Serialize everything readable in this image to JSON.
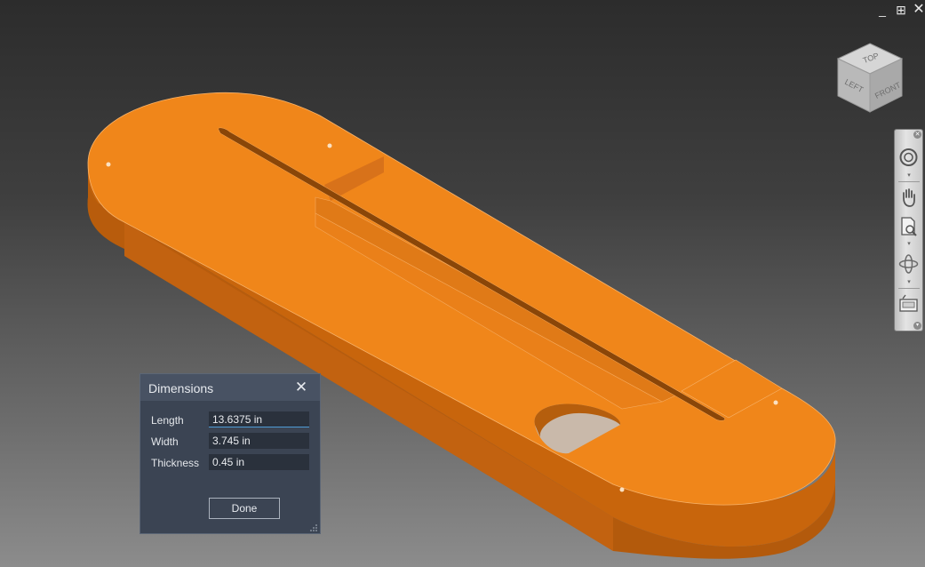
{
  "window": {
    "minimize_icon": "minimize-icon",
    "restore_icon": "restore-icon",
    "close_icon": "close-icon"
  },
  "viewcube": {
    "top": "TOP",
    "left": "LEFT",
    "front": "FRONT"
  },
  "navbar": {
    "items": [
      "steering-wheel-icon",
      "pan-icon",
      "zoom-icon",
      "orbit-icon",
      "look-at-icon"
    ]
  },
  "dialog": {
    "title": "Dimensions",
    "fields": [
      {
        "label": "Length",
        "value": "13.6375 in"
      },
      {
        "label": "Width",
        "value": "3.745 in"
      },
      {
        "label": "Thickness",
        "value": "0.45 in"
      }
    ],
    "done_label": "Done"
  },
  "colors": {
    "part_orange": "#f0861a",
    "part_side": "#c8650c",
    "dialog_bg": "#3b4453"
  }
}
